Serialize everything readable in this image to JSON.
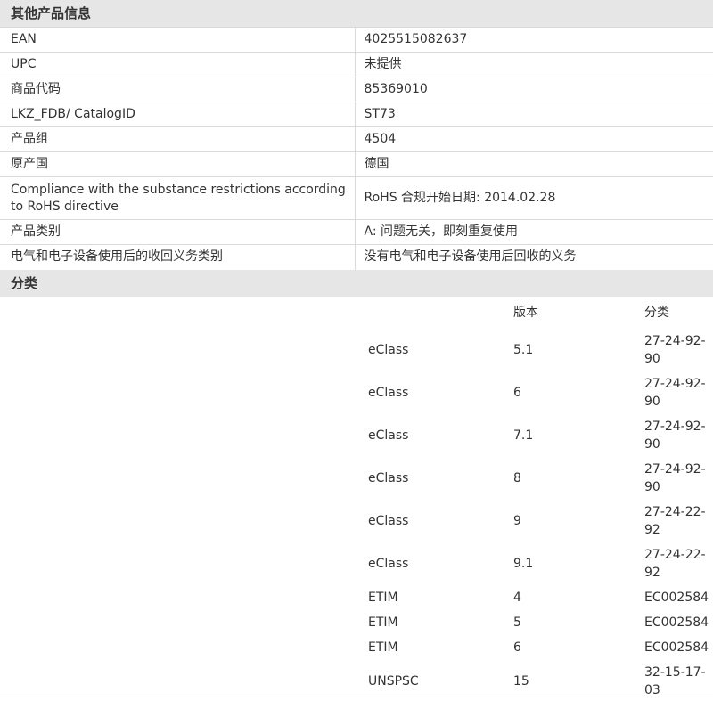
{
  "other_info": {
    "header": "其他产品信息",
    "rows": [
      {
        "key": "EAN",
        "value": "4025515082637"
      },
      {
        "key": "UPC",
        "value": "未提供"
      },
      {
        "key": "商品代码",
        "value": "85369010"
      },
      {
        "key": "LKZ_FDB/ CatalogID",
        "value": "ST73"
      },
      {
        "key": "产品组",
        "value": "4504"
      },
      {
        "key": "原产国",
        "value": "德国"
      },
      {
        "key": "Compliance with the substance restrictions according to RoHS directive",
        "value": "RoHS 合规开始日期: 2014.02.28"
      },
      {
        "key": "产品类别",
        "value": "A: 问题无关，即刻重复使用"
      },
      {
        "key": "电气和电子设备使用后的收回义务类别",
        "value": "没有电气和电子设备使用后回收的义务"
      }
    ]
  },
  "classification": {
    "header": "分类",
    "columns": [
      "",
      "版本",
      "分类"
    ],
    "rows": [
      {
        "system": "eClass",
        "version": "5.1",
        "code": "27-24-92-90"
      },
      {
        "system": "eClass",
        "version": "6",
        "code": "27-24-92-90"
      },
      {
        "system": "eClass",
        "version": "7.1",
        "code": "27-24-92-90"
      },
      {
        "system": "eClass",
        "version": "8",
        "code": "27-24-92-90"
      },
      {
        "system": "eClass",
        "version": "9",
        "code": "27-24-22-92"
      },
      {
        "system": "eClass",
        "version": "9.1",
        "code": "27-24-22-92"
      },
      {
        "system": "ETIM",
        "version": "4",
        "code": "EC002584"
      },
      {
        "system": "ETIM",
        "version": "5",
        "code": "EC002584"
      },
      {
        "system": "ETIM",
        "version": "6",
        "code": "EC002584"
      },
      {
        "system": "UNSPSC",
        "version": "15",
        "code": "32-15-17-03"
      }
    ]
  }
}
